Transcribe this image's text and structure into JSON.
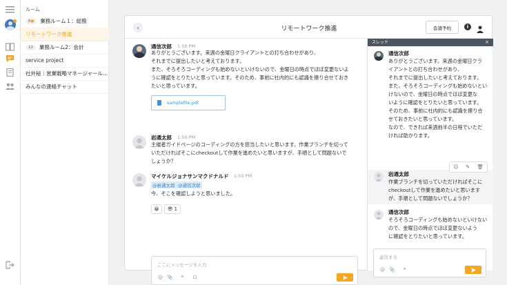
{
  "rooms": {
    "section_label": "ルーム",
    "items": [
      {
        "badge": "6",
        "label": "業務ルーム１：総務"
      },
      {
        "badge": "",
        "label": "リモートワーク推進"
      },
      {
        "badge": "12",
        "label": "業務ルーム2：会計"
      },
      {
        "badge": "",
        "label": "service project"
      },
      {
        "badge": "",
        "label": "社外秘｜営業戦略マネージャール..."
      },
      {
        "badge": "",
        "label": "みんなの連絡チャット"
      }
    ]
  },
  "header": {
    "title": "リモートワーク推進",
    "reserve_label": "会議予約",
    "info_icon_text": "i"
  },
  "messages": [
    {
      "sender": "通信次郎",
      "time": "1:50 PM",
      "lines": [
        "ありがとうございます。来週の金曜日クライアントとの打ち合わせがあり、",
        "それまでに提出したいと考えております。",
        "また、そろそろコーディングも始めないといけないので、金曜日の時点でほぼ変更ないよ",
        "うに確認をとりたいと思っています。そのため、事前に社内的にも認識を擦り合せておき",
        "たいと思っています。"
      ],
      "file": "samplefile.pdf"
    },
    {
      "sender": "岩通太郎",
      "time": "1:50 PM",
      "lines": [
        "主催者ガイドページのコーディングの方を担当したいと思います。作業ブランチを切って",
        "いただければそこにcheckoutして作業を進めたいと思いますが、手順として問題ないで",
        "しょうか？"
      ]
    },
    {
      "sender": "マイケルジョナサンマクドナルド",
      "time": "1:50 PM",
      "mentions": [
        "@岩通太郎",
        "@通信次郎"
      ],
      "lines": [
        "今、そこを確認しようと思いました。"
      ],
      "reactions": [
        "😀",
        "😎 1"
      ]
    }
  ],
  "composer": {
    "placeholder": "ここにメッセージを入力",
    "tools": [
      "@",
      "📎",
      "❝",
      "⊡"
    ]
  },
  "thread": {
    "title": "スレッド",
    "close": "×",
    "messages": [
      {
        "sender": "通信次郎",
        "lines": [
          "ありがとうございます。来週の金曜日クラ",
          "イアントとの打ち合わせがあり、",
          "それまでに提出したいと考えております。",
          "また、そろそろコーディングも始めないとい",
          "けないので、金曜日の時点でほぼ変更な",
          "いように確認をとりたいと思っています。",
          "そのため、事前に社内的にも認識を擦り合",
          "せておきたいと思っています。",
          "なので、できれば来週前半の日程でいただ",
          "ければ助かります。"
        ]
      },
      {
        "sender": "岩通太郎",
        "lines": [
          "作業ブランチを切っていただければそこに",
          "checkoutして作業を進めたいと思います",
          "が、手順として問題ないでしょうか？"
        ]
      },
      {
        "sender": "通信次郎",
        "lines": [
          "そろそろコーディングも始めないといけない",
          "ので、金曜日の時点でほぼ変更ないよう",
          "に確認をとりたいと思っています。"
        ]
      }
    ],
    "hover_tools": [
      "☺",
      "✎",
      "🗑"
    ],
    "placeholder": "返信する",
    "tools": [
      "@",
      "📎",
      "❝"
    ]
  }
}
